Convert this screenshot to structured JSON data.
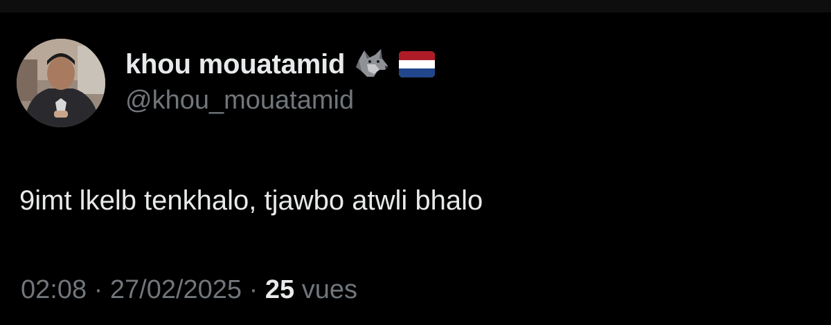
{
  "tweet": {
    "author": {
      "display_name": "khou mouatamid",
      "handle": "@khou_mouatamid",
      "avatar": "profile-photo",
      "badges": [
        "wolf-emoji",
        "netherlands-flag-emoji"
      ]
    },
    "text": "9imt lkelb tenkhalo, tjawbo atwli bhalo",
    "time": "02:08",
    "separator": "·",
    "date": "27/02/2025",
    "views_count": "25",
    "views_label": "vues"
  },
  "colors": {
    "background": "#000000",
    "primary_text": "#e7e9ea",
    "secondary_text": "#71767b",
    "flag_red": "#ae1c28",
    "flag_white": "#ffffff",
    "flag_blue": "#21468b"
  }
}
